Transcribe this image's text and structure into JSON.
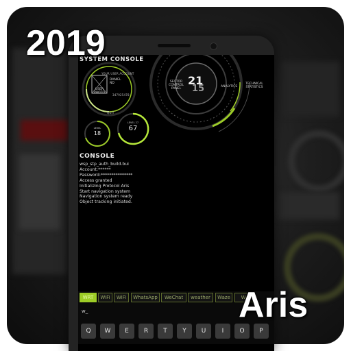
{
  "overlay": {
    "year": "2019",
    "app_name": "Aris"
  },
  "hud": {
    "title": "SYSTEM CONSOLE",
    "user_account_label": "YOUR USER ACCOUNT",
    "user_photo": [
      "USER",
      "PHOTO"
    ],
    "user_name": [
      "DANIEL",
      "ND"
    ],
    "phone": "347925478",
    "quit": "QUIT",
    "gauge_small": {
      "label": "LEVEL",
      "value": "18"
    },
    "gauge_large": {
      "label": "LEVEL 27",
      "value": "67"
    },
    "sector_control": [
      "SECTOR",
      "CONTROL",
      "PANEL"
    ],
    "clock_hour": "21",
    "clock_minute": "15",
    "analytics": "ANALYTICS",
    "technical_stats": [
      "TECHNICAL",
      "STATISTICS"
    ]
  },
  "console": {
    "title": "CONSOLE",
    "lines": [
      "wsp_stp_auth_build.bui",
      "Account:******",
      "Password:***************",
      "Access granted",
      "Initializing Protocol Aris",
      "Start navigation system",
      "Navigation system ready",
      "Object tracking initiated."
    ]
  },
  "suggestions": [
    "WRT",
    "WiFi",
    "WiFi",
    "WhatsApp",
    "WeChat",
    "weather",
    "Waze",
    "We"
  ],
  "input": {
    "typed": "w_"
  },
  "keyboard": {
    "row1": [
      "Q",
      "W",
      "E",
      "R",
      "T",
      "Y",
      "U",
      "I",
      "O",
      "P"
    ]
  },
  "colors": {
    "accent": "#9dcc27",
    "screen_bg": "#000000",
    "chip_border": "#5d6b2c"
  }
}
